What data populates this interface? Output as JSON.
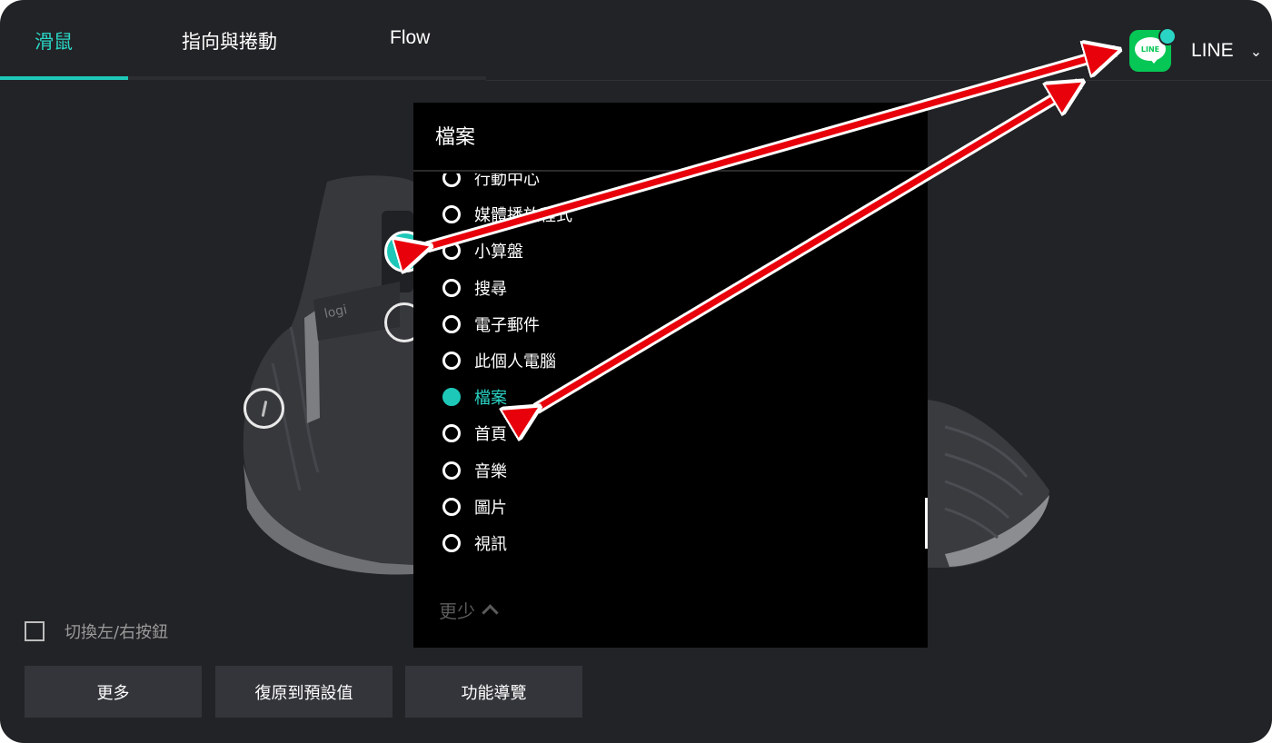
{
  "tabs": [
    {
      "label": "滑鼠",
      "active": true
    },
    {
      "label": "指向與捲動",
      "active": false
    },
    {
      "label": "Flow",
      "active": false
    }
  ],
  "app_selector": {
    "logo_text": "LINE",
    "app_name": "LINE",
    "icon": "chevron-down-icon"
  },
  "menu": {
    "title": "檔案",
    "items": [
      {
        "label": "行動中心",
        "selected": false
      },
      {
        "label": "媒體播放程式",
        "selected": false
      },
      {
        "label": "小算盤",
        "selected": false
      },
      {
        "label": "搜尋",
        "selected": false
      },
      {
        "label": "電子郵件",
        "selected": false
      },
      {
        "label": "此個人電腦",
        "selected": false
      },
      {
        "label": "檔案",
        "selected": true
      },
      {
        "label": "首頁",
        "selected": false
      },
      {
        "label": "音樂",
        "selected": false
      },
      {
        "label": "圖片",
        "selected": false
      },
      {
        "label": "視訊",
        "selected": false
      }
    ],
    "less_label": "更少"
  },
  "device_label": "logi",
  "swap_buttons": {
    "label": "切換左/右按鈕",
    "checked": false
  },
  "buttons": {
    "more": "更多",
    "reset": "復原到預設值",
    "tour": "功能導覽"
  },
  "colors": {
    "accent": "#1ec8b8",
    "background": "#222326",
    "menu_bg": "#000000",
    "annotation_arrow": "#e8000b",
    "line_brand": "#06c755"
  }
}
